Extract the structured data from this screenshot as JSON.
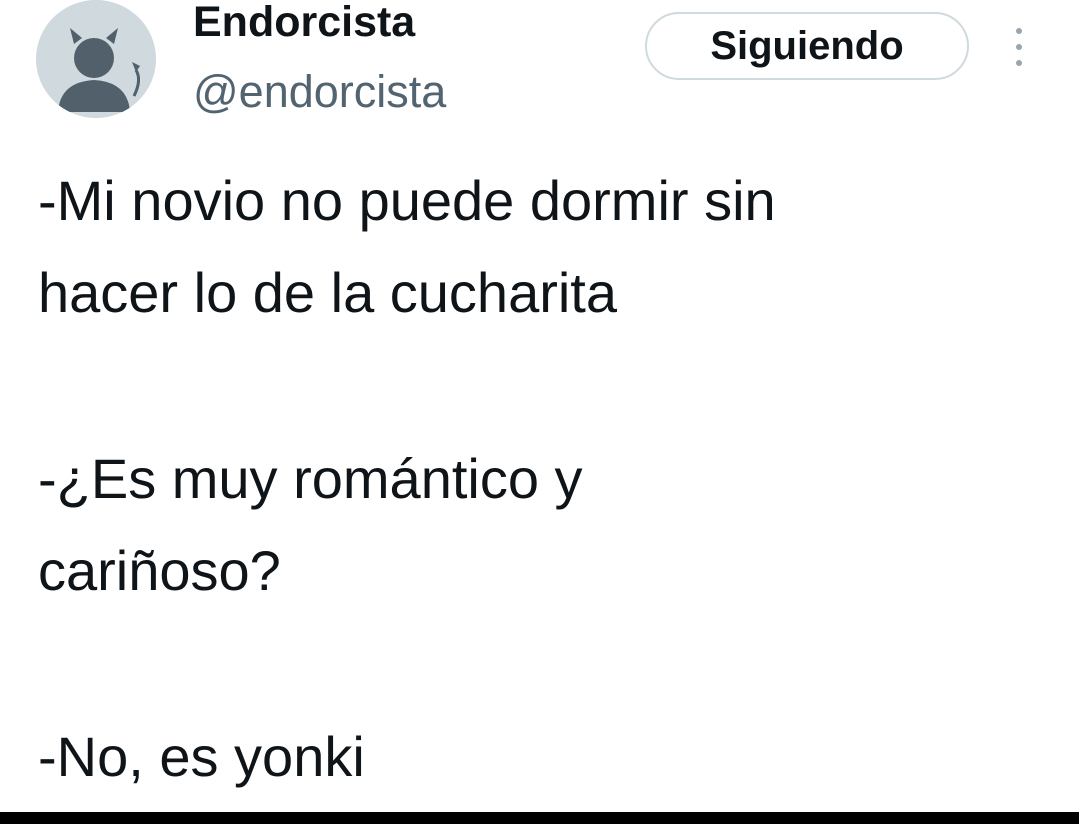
{
  "author": {
    "display_name": "Endorcista",
    "handle": "@endorcista",
    "avatar_icon": "devil-avatar-icon"
  },
  "follow_button": {
    "label": "Siguiendo"
  },
  "more_menu": {
    "icon": "vertical-ellipsis-icon"
  },
  "tweet": {
    "lines": [
      "-Mi novio no puede dormir sin",
      "hacer lo de la cucharita",
      "-¿Es muy romántico y",
      "cariñoso?",
      "-No, es yonki"
    ]
  },
  "colors": {
    "text": "#0f1419",
    "secondary": "#536471",
    "border": "#cfd9de",
    "avatar_bg": "#cfd9de"
  }
}
